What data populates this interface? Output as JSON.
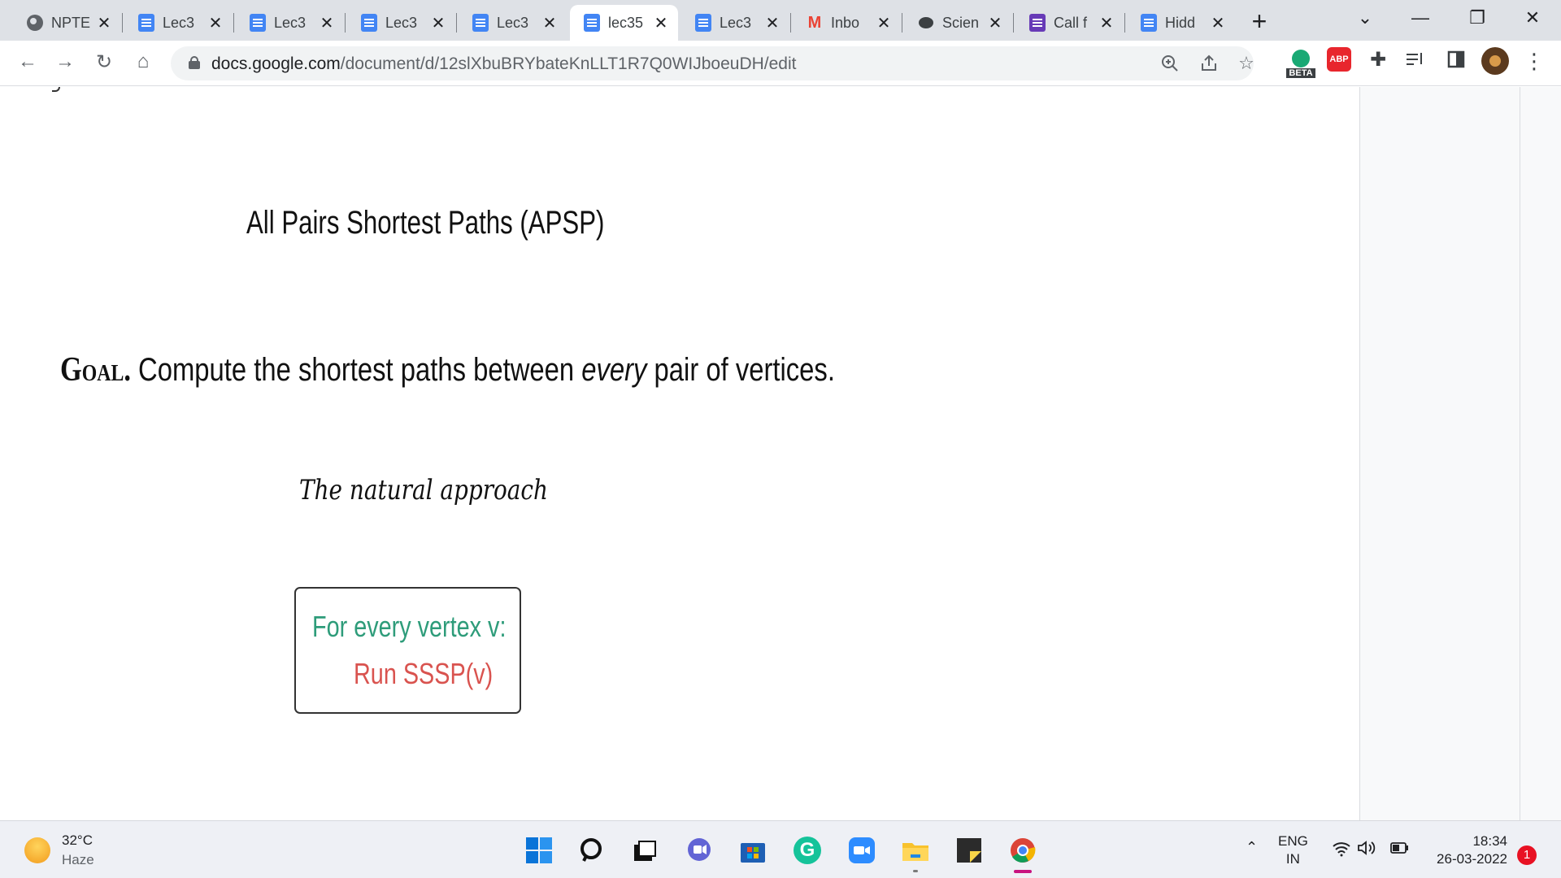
{
  "browser": {
    "tabs": [
      {
        "label": "NPTE",
        "icon": "globe-icon"
      },
      {
        "label": "Lec3",
        "icon": "google-docs-icon"
      },
      {
        "label": "Lec3",
        "icon": "google-docs-icon"
      },
      {
        "label": "Lec3",
        "icon": "google-docs-icon"
      },
      {
        "label": "Lec3",
        "icon": "google-docs-icon"
      },
      {
        "label": "lec35",
        "icon": "google-docs-icon",
        "active": true
      },
      {
        "label": "Lec3",
        "icon": "google-docs-icon"
      },
      {
        "label": "Inbo",
        "icon": "gmail-icon"
      },
      {
        "label": "Scien",
        "icon": "chat-icon"
      },
      {
        "label": "Call f",
        "icon": "google-forms-icon"
      },
      {
        "label": "Hidd",
        "icon": "google-docs-icon"
      }
    ],
    "new_tab_glyph": "+",
    "url_host": "docs.google.com",
    "url_path": "/document/d/12slXbuBRYbateKnLLT1R7Q0WIJboeuDH/edit",
    "extensions": {
      "beta_badge": "BETA",
      "abp_badge": "ABP"
    }
  },
  "document": {
    "slide_title": "All Pairs Shortest Paths (APSP)",
    "goal_keyword": "Goal.",
    "goal_text_before": " Compute the shortest paths between ",
    "goal_emphasis": "every",
    "goal_text_after": " pair of vertices.",
    "natural_approach": "The natural approach",
    "algorithm": {
      "line1": "For every vertex v:",
      "line2": "Run SSSP(v)",
      "line1_color": "#2e9c7a",
      "line2_color": "#d9534f"
    }
  },
  "taskbar": {
    "weather_temp": "32°C",
    "weather_condition": "Haze",
    "language_primary": "ENG",
    "language_secondary": "IN",
    "time": "18:34",
    "date": "26-03-2022",
    "notification_count": "1"
  }
}
